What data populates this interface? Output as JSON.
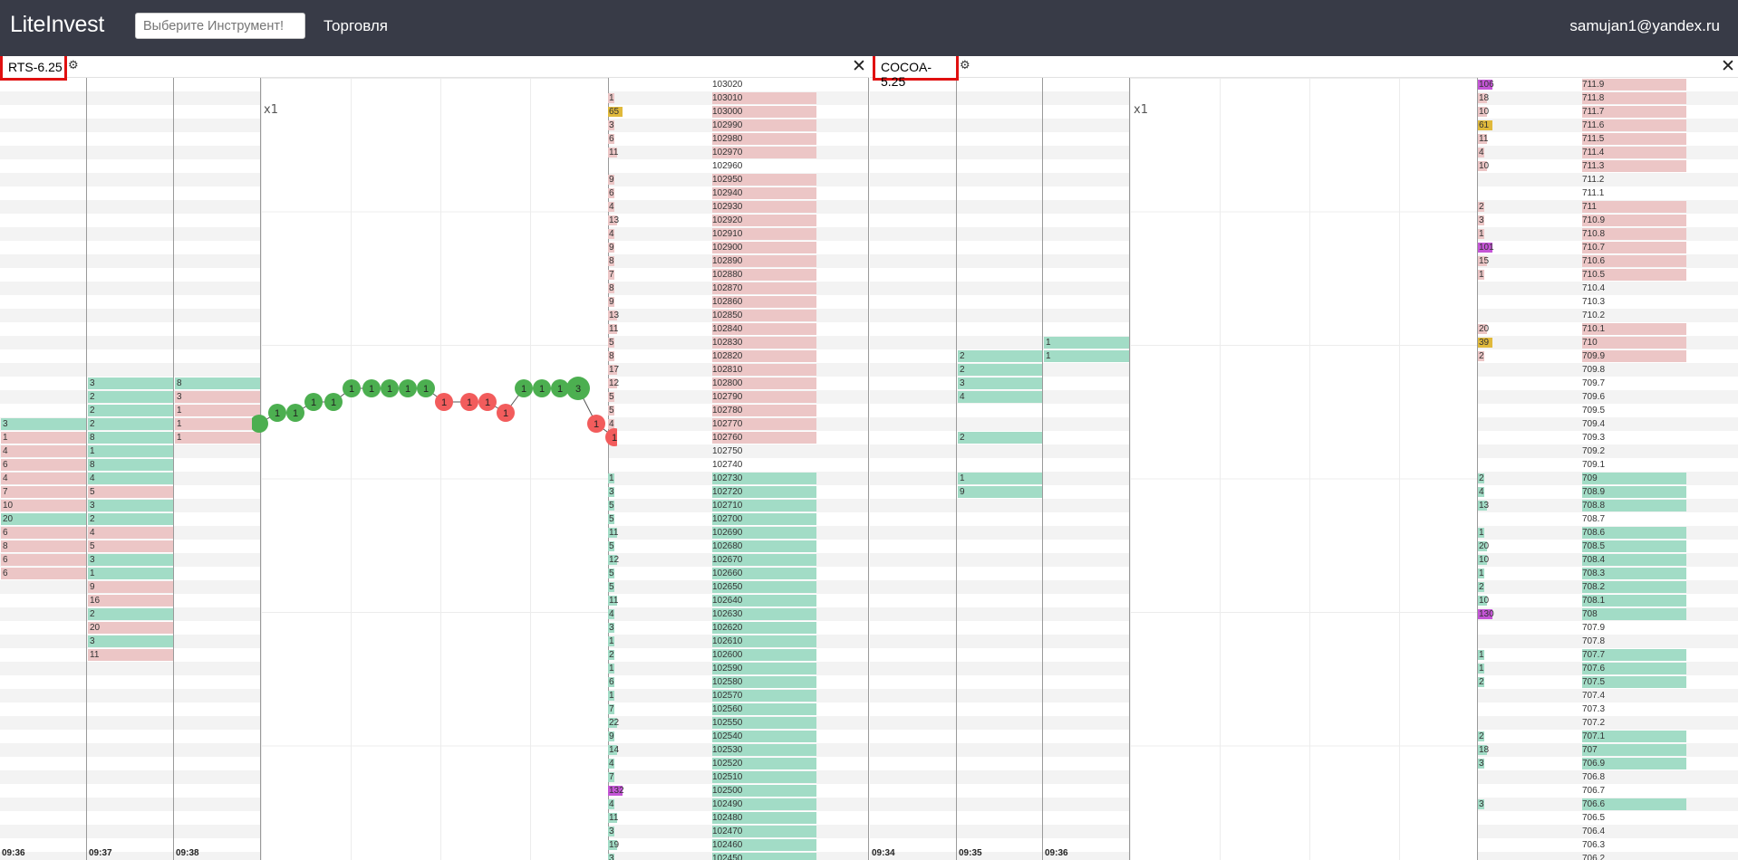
{
  "app": {
    "logo": "LiteInvest",
    "search_placeholder": "Выберите Инструмент!",
    "nav_trade": "Торговля",
    "user": "samujan1@yandex.ru"
  },
  "panels": [
    {
      "title": "RTS-6.25",
      "scale": "x1",
      "time_labels": [
        "09:36",
        "09:37",
        "09:38"
      ],
      "columns": [
        {
          "cells": [
            [
              25,
              "3",
              "g"
            ],
            [
              26,
              "1",
              "r"
            ],
            [
              27,
              "4",
              "r"
            ],
            [
              28,
              "6",
              "r"
            ],
            [
              29,
              "4",
              "r"
            ],
            [
              30,
              "7",
              "r"
            ],
            [
              31,
              "10",
              "r"
            ],
            [
              32,
              "20",
              "g"
            ],
            [
              33,
              "6",
              "r"
            ],
            [
              34,
              "8",
              "r"
            ],
            [
              35,
              "6",
              "r"
            ],
            [
              36,
              "6",
              "r"
            ]
          ]
        },
        {
          "cells": [
            [
              22,
              "3",
              "g"
            ],
            [
              23,
              "2",
              "g"
            ],
            [
              24,
              "2",
              "g"
            ],
            [
              25,
              "2",
              "g"
            ],
            [
              26,
              "8",
              "g"
            ],
            [
              27,
              "1",
              "g"
            ],
            [
              28,
              "8",
              "g"
            ],
            [
              29,
              "4",
              "g"
            ],
            [
              30,
              "5",
              "r"
            ],
            [
              31,
              "3",
              "g"
            ],
            [
              32,
              "2",
              "g"
            ],
            [
              33,
              "4",
              "r"
            ],
            [
              34,
              "5",
              "r"
            ],
            [
              35,
              "3",
              "g"
            ],
            [
              36,
              "1",
              "g"
            ],
            [
              37,
              "9",
              "r"
            ],
            [
              38,
              "16",
              "r"
            ],
            [
              39,
              "2",
              "g"
            ],
            [
              40,
              "20",
              "r"
            ],
            [
              41,
              "3",
              "g"
            ],
            [
              42,
              "11",
              "r"
            ]
          ]
        },
        {
          "cells": [
            [
              22,
              "8",
              "g"
            ],
            [
              23,
              "3",
              "r"
            ],
            [
              24,
              "1",
              "r"
            ],
            [
              25,
              "1",
              "r"
            ],
            [
              26,
              "1",
              "r"
            ]
          ]
        }
      ],
      "trades": [
        {
          "row": 25.0,
          "v": "",
          "s": "buy"
        },
        {
          "row": 24.2,
          "v": "1",
          "s": "buy"
        },
        {
          "row": 24.2,
          "v": "1",
          "s": "buy"
        },
        {
          "row": 23.4,
          "v": "1",
          "s": "buy"
        },
        {
          "row": 23.4,
          "v": "1",
          "s": "buy"
        },
        {
          "row": 22.4,
          "v": "1",
          "s": "buy"
        },
        {
          "row": 22.4,
          "v": "1",
          "s": "buy"
        },
        {
          "row": 22.4,
          "v": "1",
          "s": "buy"
        },
        {
          "row": 22.4,
          "v": "1",
          "s": "buy"
        },
        {
          "row": 22.4,
          "v": "1",
          "s": "buy"
        },
        {
          "row": 23.4,
          "v": "1",
          "s": "sell"
        },
        {
          "row": 23.4,
          "v": "1",
          "s": "sell"
        },
        {
          "row": 23.4,
          "v": "1",
          "s": "sell"
        },
        {
          "row": 24.2,
          "v": "1",
          "s": "sell"
        },
        {
          "row": 22.4,
          "v": "1",
          "s": "buy"
        },
        {
          "row": 22.4,
          "v": "1",
          "s": "buy"
        },
        {
          "row": 22.4,
          "v": "1",
          "s": "buy"
        },
        {
          "row": 22.4,
          "v": "3",
          "s": "buy"
        },
        {
          "row": 25.0,
          "v": "1",
          "s": "sell"
        },
        {
          "row": 26.0,
          "v": "1",
          "s": "sell"
        }
      ],
      "book": [
        {
          "p": "103020"
        },
        {
          "p": "103010",
          "v": "1",
          "s": "a"
        },
        {
          "p": "103000",
          "v": "65",
          "s": "a",
          "tag": "y"
        },
        {
          "p": "102990",
          "v": "3",
          "s": "a"
        },
        {
          "p": "102980",
          "v": "6",
          "s": "a"
        },
        {
          "p": "102970",
          "v": "11",
          "s": "a"
        },
        {
          "p": "102960"
        },
        {
          "p": "102950",
          "v": "9",
          "s": "a"
        },
        {
          "p": "102940",
          "v": "6",
          "s": "a"
        },
        {
          "p": "102930",
          "v": "4",
          "s": "a"
        },
        {
          "p": "102920",
          "v": "13",
          "s": "a"
        },
        {
          "p": "102910",
          "v": "4",
          "s": "a"
        },
        {
          "p": "102900",
          "v": "9",
          "s": "a"
        },
        {
          "p": "102890",
          "v": "8",
          "s": "a"
        },
        {
          "p": "102880",
          "v": "7",
          "s": "a"
        },
        {
          "p": "102870",
          "v": "8",
          "s": "a"
        },
        {
          "p": "102860",
          "v": "9",
          "s": "a"
        },
        {
          "p": "102850",
          "v": "13",
          "s": "a"
        },
        {
          "p": "102840",
          "v": "11",
          "s": "a"
        },
        {
          "p": "102830",
          "v": "5",
          "s": "a"
        },
        {
          "p": "102820",
          "v": "8",
          "s": "a"
        },
        {
          "p": "102810",
          "v": "17",
          "s": "a"
        },
        {
          "p": "102800",
          "v": "12",
          "s": "a"
        },
        {
          "p": "102790",
          "v": "5",
          "s": "a"
        },
        {
          "p": "102780",
          "v": "5",
          "s": "a"
        },
        {
          "p": "102770",
          "v": "4",
          "s": "a"
        },
        {
          "p": "102760",
          "v": "4",
          "s": "a"
        },
        {
          "p": "102750"
        },
        {
          "p": "102740"
        },
        {
          "p": "102730",
          "v": "1",
          "s": "b"
        },
        {
          "p": "102720",
          "v": "3",
          "s": "b"
        },
        {
          "p": "102710",
          "v": "5",
          "s": "b"
        },
        {
          "p": "102700",
          "v": "5",
          "s": "b"
        },
        {
          "p": "102690",
          "v": "11",
          "s": "b"
        },
        {
          "p": "102680",
          "v": "5",
          "s": "b"
        },
        {
          "p": "102670",
          "v": "12",
          "s": "b"
        },
        {
          "p": "102660",
          "v": "5",
          "s": "b"
        },
        {
          "p": "102650",
          "v": "5",
          "s": "b"
        },
        {
          "p": "102640",
          "v": "11",
          "s": "b"
        },
        {
          "p": "102630",
          "v": "4",
          "s": "b"
        },
        {
          "p": "102620",
          "v": "3",
          "s": "b"
        },
        {
          "p": "102610",
          "v": "1",
          "s": "b"
        },
        {
          "p": "102600",
          "v": "2",
          "s": "b"
        },
        {
          "p": "102590",
          "v": "1",
          "s": "b"
        },
        {
          "p": "102580",
          "v": "6",
          "s": "b"
        },
        {
          "p": "102570",
          "v": "1",
          "s": "b"
        },
        {
          "p": "102560",
          "v": "7",
          "s": "b"
        },
        {
          "p": "102550",
          "v": "22",
          "s": "b"
        },
        {
          "p": "102540",
          "v": "9",
          "s": "b"
        },
        {
          "p": "102530",
          "v": "14",
          "s": "b"
        },
        {
          "p": "102520",
          "v": "4",
          "s": "b"
        },
        {
          "p": "102510",
          "v": "7",
          "s": "b"
        },
        {
          "p": "102500",
          "v": "132",
          "s": "b",
          "tag": "p"
        },
        {
          "p": "102490",
          "v": "4",
          "s": "b"
        },
        {
          "p": "102480",
          "v": "11",
          "s": "b"
        },
        {
          "p": "102470",
          "v": "3",
          "s": "b"
        },
        {
          "p": "102460",
          "v": "19",
          "s": "b"
        },
        {
          "p": "102450",
          "v": "3",
          "s": "b"
        }
      ]
    },
    {
      "title": "COCOA-5.25",
      "scale": "x1",
      "time_labels": [
        "09:34",
        "09:35",
        "09:36"
      ],
      "columns": [
        {
          "cells": []
        },
        {
          "cells": [
            [
              20,
              "2",
              "g"
            ],
            [
              21,
              "2",
              "g"
            ],
            [
              22,
              "3",
              "g"
            ],
            [
              23,
              "4",
              "g"
            ],
            [
              26,
              "2",
              "g"
            ],
            [
              29,
              "1",
              "g"
            ],
            [
              30,
              "9",
              "g"
            ]
          ]
        },
        {
          "cells": [
            [
              19,
              "1",
              "g"
            ],
            [
              20,
              "1",
              "g"
            ]
          ]
        }
      ],
      "trades": [],
      "book": [
        {
          "p": "711.9",
          "v": "106",
          "s": "a",
          "tag": "p"
        },
        {
          "p": "711.8",
          "v": "18",
          "s": "a"
        },
        {
          "p": "711.7",
          "v": "10",
          "s": "a"
        },
        {
          "p": "711.6",
          "v": "61",
          "s": "a",
          "tag": "y"
        },
        {
          "p": "711.5",
          "v": "11",
          "s": "a"
        },
        {
          "p": "711.4",
          "v": "4",
          "s": "a"
        },
        {
          "p": "711.3",
          "v": "10",
          "s": "a"
        },
        {
          "p": "711.2"
        },
        {
          "p": "711.1"
        },
        {
          "p": "711",
          "v": "2",
          "s": "a"
        },
        {
          "p": "710.9",
          "v": "3",
          "s": "a"
        },
        {
          "p": "710.8",
          "v": "1",
          "s": "a"
        },
        {
          "p": "710.7",
          "v": "101",
          "s": "a",
          "tag": "p"
        },
        {
          "p": "710.6",
          "v": "15",
          "s": "a"
        },
        {
          "p": "710.5",
          "v": "1",
          "s": "a"
        },
        {
          "p": "710.4"
        },
        {
          "p": "710.3"
        },
        {
          "p": "710.2"
        },
        {
          "p": "710.1",
          "v": "20",
          "s": "a"
        },
        {
          "p": "710",
          "v": "39",
          "s": "a",
          "tag": "y"
        },
        {
          "p": "709.9",
          "v": "2",
          "s": "a"
        },
        {
          "p": "709.8"
        },
        {
          "p": "709.7"
        },
        {
          "p": "709.6"
        },
        {
          "p": "709.5"
        },
        {
          "p": "709.4"
        },
        {
          "p": "709.3"
        },
        {
          "p": "709.2"
        },
        {
          "p": "709.1"
        },
        {
          "p": "709",
          "v": "2",
          "s": "b"
        },
        {
          "p": "708.9",
          "v": "4",
          "s": "b"
        },
        {
          "p": "708.8",
          "v": "13",
          "s": "b"
        },
        {
          "p": "708.7"
        },
        {
          "p": "708.6",
          "v": "1",
          "s": "b"
        },
        {
          "p": "708.5",
          "v": "20",
          "s": "b"
        },
        {
          "p": "708.4",
          "v": "10",
          "s": "b"
        },
        {
          "p": "708.3",
          "v": "1",
          "s": "b"
        },
        {
          "p": "708.2",
          "v": "2",
          "s": "b"
        },
        {
          "p": "708.1",
          "v": "10",
          "s": "b"
        },
        {
          "p": "708",
          "v": "130",
          "s": "b",
          "tag": "p"
        },
        {
          "p": "707.9"
        },
        {
          "p": "707.8"
        },
        {
          "p": "707.7",
          "v": "1",
          "s": "b"
        },
        {
          "p": "707.6",
          "v": "1",
          "s": "b"
        },
        {
          "p": "707.5",
          "v": "2",
          "s": "b"
        },
        {
          "p": "707.4"
        },
        {
          "p": "707.3"
        },
        {
          "p": "707.2"
        },
        {
          "p": "707.1",
          "v": "2",
          "s": "b"
        },
        {
          "p": "707",
          "v": "18",
          "s": "b"
        },
        {
          "p": "706.9",
          "v": "3",
          "s": "b"
        },
        {
          "p": "706.8"
        },
        {
          "p": "706.7"
        },
        {
          "p": "706.6",
          "v": "3",
          "s": "b"
        },
        {
          "p": "706.5"
        },
        {
          "p": "706.4"
        },
        {
          "p": "706.3"
        },
        {
          "p": "706.2"
        }
      ]
    }
  ]
}
